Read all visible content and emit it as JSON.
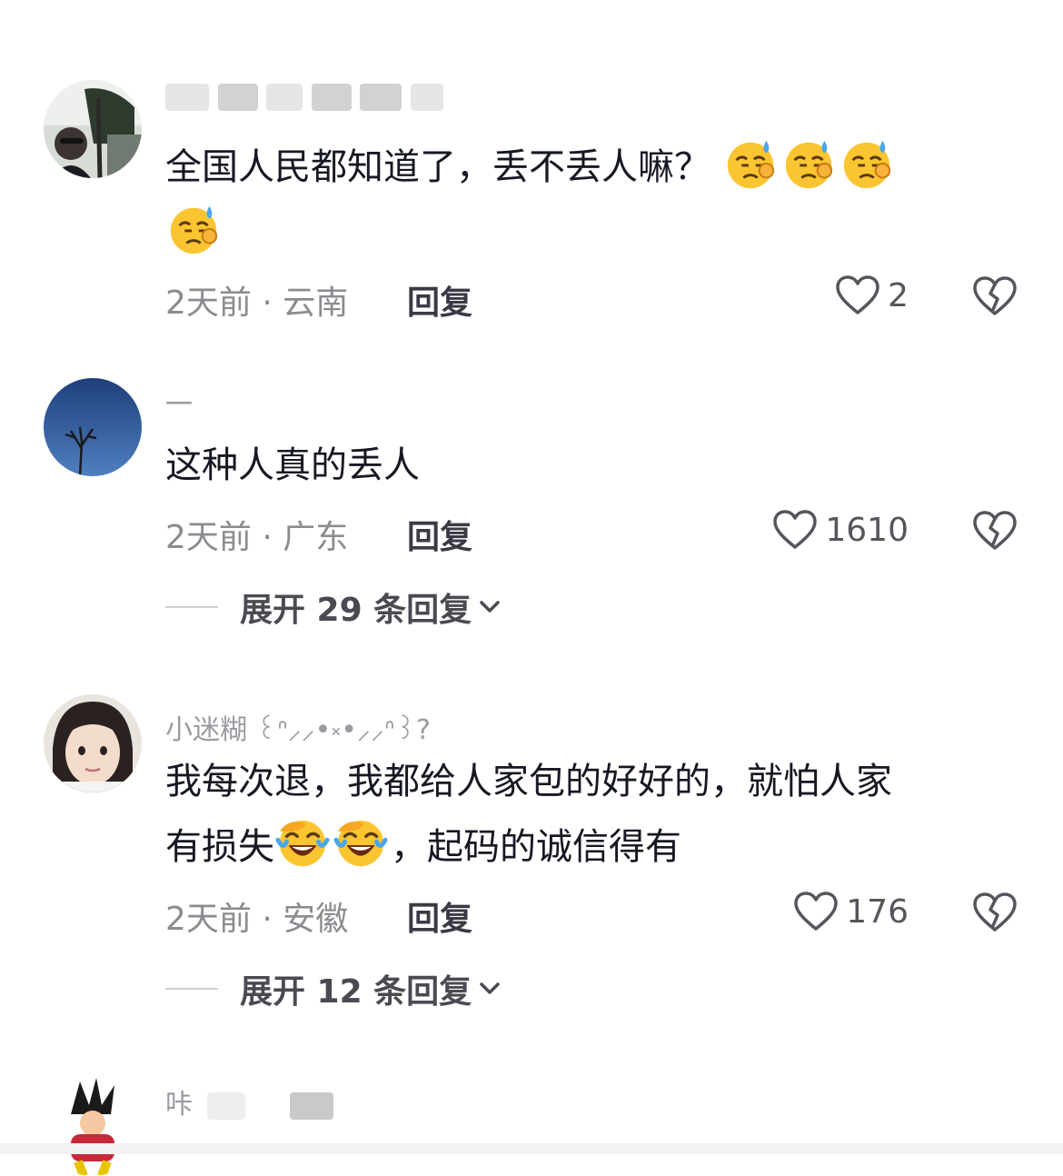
{
  "comments": [
    {
      "text": "全国人民都知道了，丢不丢人嘛？",
      "meta": "2天前 · 云南",
      "reply": "回复",
      "likes": "2",
      "emoji": "sweating-face-emoji"
    },
    {
      "username": "一",
      "text": "这种人真的丢人",
      "meta": "2天前 · 广东",
      "reply": "回复",
      "likes": "1610",
      "expand": "展开 29 条回复"
    },
    {
      "username": "小迷糊 ꒰ᐢ⸝⸝•༝•⸝⸝ᐢ꒱?",
      "text_a": "我每次退，我都给人家包的好好的，就怕人家",
      "text_b_pre": "有损失",
      "text_b_post": "，起码的诚信得有",
      "meta": "2天前 · 安徽",
      "reply": "回复",
      "likes": "176",
      "expand": "展开 12 条回复",
      "emoji": "laughing-crying-face-emoji"
    },
    {
      "username_visible": "咔"
    }
  ],
  "icons": {
    "like": "heart-outline-icon",
    "dislike": "broken-heart-icon",
    "expand": "chevron-down-icon"
  },
  "colors": {
    "text": "#161823",
    "meta": "#8b8b90",
    "username": "#9a9aa0"
  }
}
